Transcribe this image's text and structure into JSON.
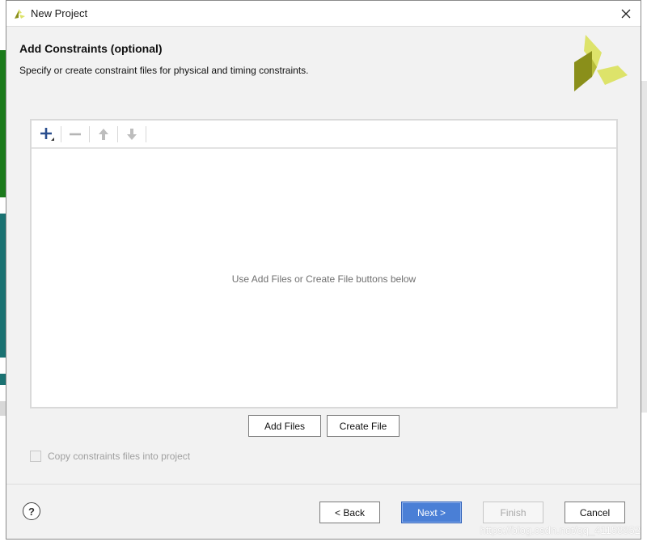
{
  "window": {
    "title": "New Project",
    "close_glyph": "✕"
  },
  "header": {
    "title": "Add Constraints (optional)",
    "subtitle": "Specify or create constraint files for physical and timing constraints."
  },
  "toolbar": {
    "icons": [
      "add-icon",
      "remove-icon",
      "move-up-icon",
      "move-down-icon"
    ]
  },
  "panel": {
    "empty_message": "Use Add Files or Create File buttons below"
  },
  "actions": {
    "add_files": "Add Files",
    "create_file": "Create File"
  },
  "options": {
    "copy_constraints_label": "Copy constraints files into project",
    "copy_constraints_checked": false
  },
  "footer": {
    "help": "?",
    "back": "< Back",
    "next": "Next >",
    "finish": "Finish",
    "cancel": "Cancel"
  },
  "watermark": "https://blog.csdn.net/qq_41158852",
  "colors": {
    "accent": "#4a7fd6",
    "logo_light": "#dde36a",
    "logo_dark": "#8a8f1a",
    "bg_strip_green": "#1a7a1a",
    "bg_strip_teal": "#1a7070"
  }
}
